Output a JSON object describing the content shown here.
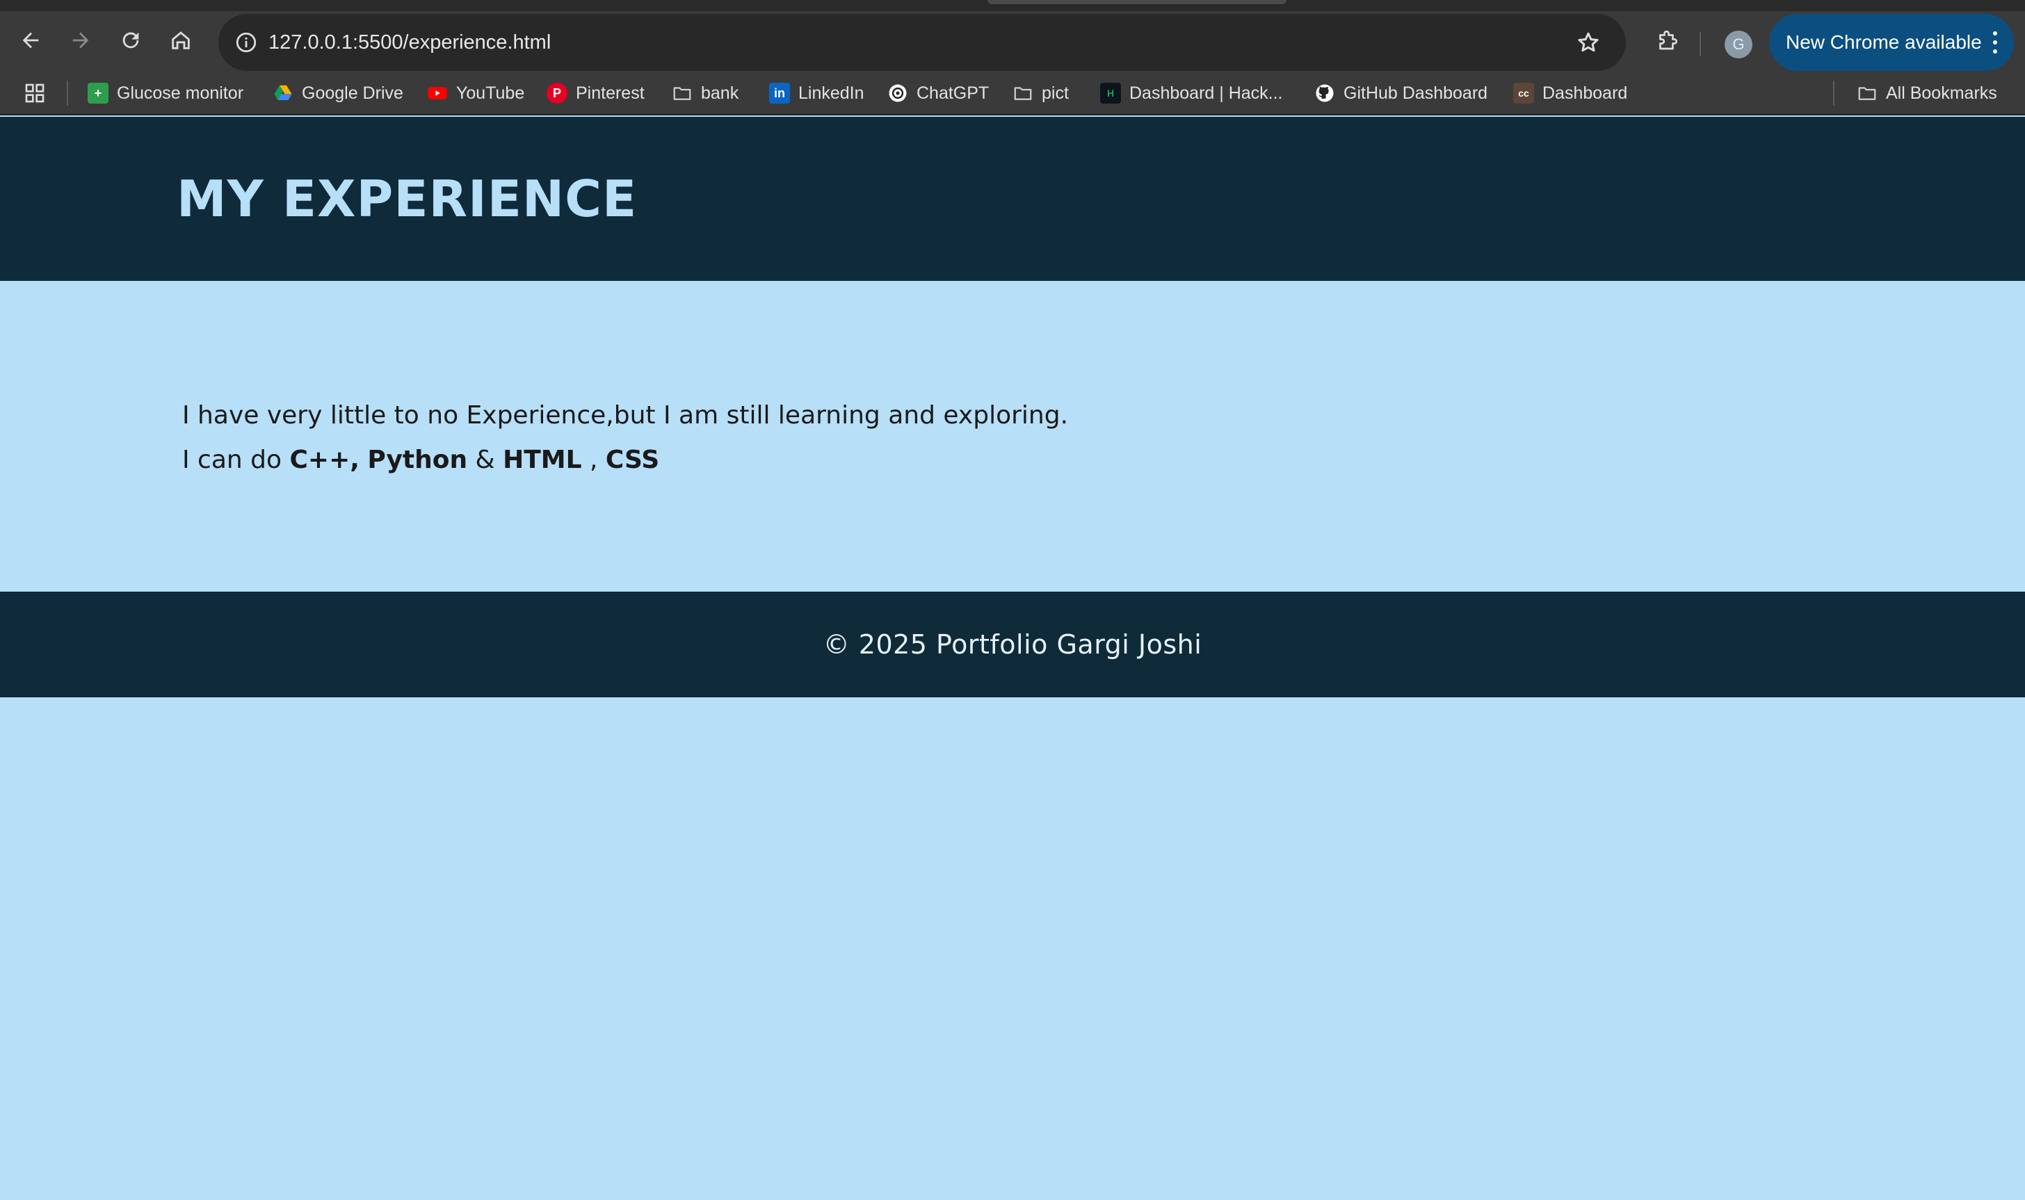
{
  "browser": {
    "url": "127.0.0.1:5500/experience.html",
    "profile_initial": "G",
    "update_label": "New Chrome available",
    "icons": {
      "back": "arrow-left-icon",
      "forward": "arrow-right-icon",
      "reload": "reload-icon",
      "home": "home-icon",
      "site_info": "info-icon",
      "bookmark": "star-icon",
      "extensions": "puzzle-icon",
      "menu": "more-vertical-icon"
    }
  },
  "bookmarks": {
    "items": [
      {
        "label": "Glucose monitor",
        "icon": "plus-square-icon",
        "color": "#2e9d4e"
      },
      {
        "label": "Google Drive",
        "icon": "drive-icon",
        "color": "#f4b400"
      },
      {
        "label": "YouTube",
        "icon": "youtube-icon",
        "color": "#ff0000"
      },
      {
        "label": "Pinterest",
        "icon": "pinterest-icon",
        "color": "#e60023"
      },
      {
        "label": "bank",
        "icon": "folder-icon",
        "color": "#d0d0d0"
      },
      {
        "label": "LinkedIn",
        "icon": "linkedin-icon",
        "color": "#0a66c2"
      },
      {
        "label": "ChatGPT",
        "icon": "chatgpt-icon",
        "color": "#ffffff"
      },
      {
        "label": "pict",
        "icon": "folder-icon",
        "color": "#d0d0d0"
      },
      {
        "label": "Dashboard | Hack...",
        "icon": "hackerrank-icon",
        "color": "#1ba94c"
      },
      {
        "label": "GitHub Dashboard",
        "icon": "github-icon",
        "color": "#ffffff"
      },
      {
        "label": "Dashboard",
        "icon": "codechef-icon",
        "color": "#5b4638"
      }
    ],
    "all_label": "All Bookmarks"
  },
  "page": {
    "title": "MY EXPERIENCE",
    "line1": "I have very little to no Experience,but I am still learning and exploring.",
    "line2_prefix": "I can do ",
    "skill1": "C++,",
    "skill2": "Python",
    "sep_and": " & ",
    "skill3": "HTML",
    "sep_comma": " , ",
    "skill4": "CSS",
    "footer": "© 2025 Portfolio Gargi Joshi",
    "colors": {
      "header_bg": "#0f2a39",
      "body_bg": "#b7dff8",
      "title_color": "#b7dff8"
    }
  }
}
